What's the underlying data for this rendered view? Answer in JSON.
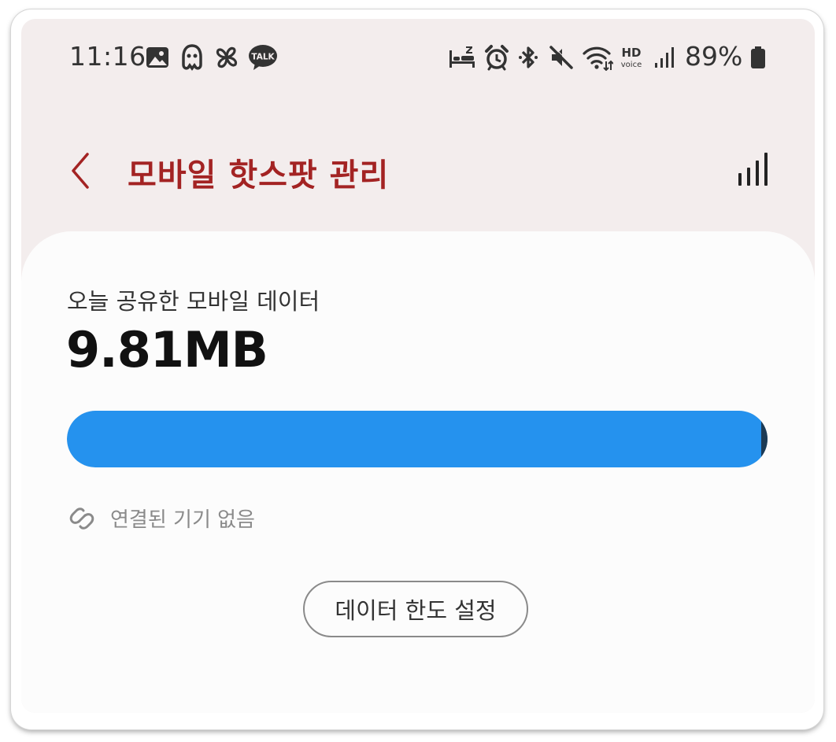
{
  "status_bar": {
    "time": "11:16",
    "battery": "89%",
    "left_icons": [
      "gallery-icon",
      "notification-app-icon",
      "pinwheel-icon",
      "kakaotalk-icon"
    ],
    "kakaotalk_label": "TALK",
    "right_icons": [
      "sleep-mode-icon",
      "alarm-icon",
      "bluetooth-icon",
      "mute-icon",
      "wifi-icon",
      "hd-voice-icon",
      "cellular-signal-icon",
      "battery-icon"
    ],
    "hd_label": "HD",
    "voice_label": "voice"
  },
  "header": {
    "title": "모바일 핫스팟 관리",
    "back_icon": "chevron-left-icon",
    "action_icon": "signal-bars-icon"
  },
  "usage": {
    "label": "오늘 공유한 모바일 데이터",
    "value": "9.81MB",
    "progress_fraction": 1.0
  },
  "connected": {
    "text": "연결된 기기 없음",
    "icon": "link-icon"
  },
  "limit_button": {
    "label": "데이터 한도 설정"
  },
  "colors": {
    "title": "#a32323",
    "progress": "#2592ee",
    "background": "#f3eded",
    "card": "#fcfcfc"
  }
}
